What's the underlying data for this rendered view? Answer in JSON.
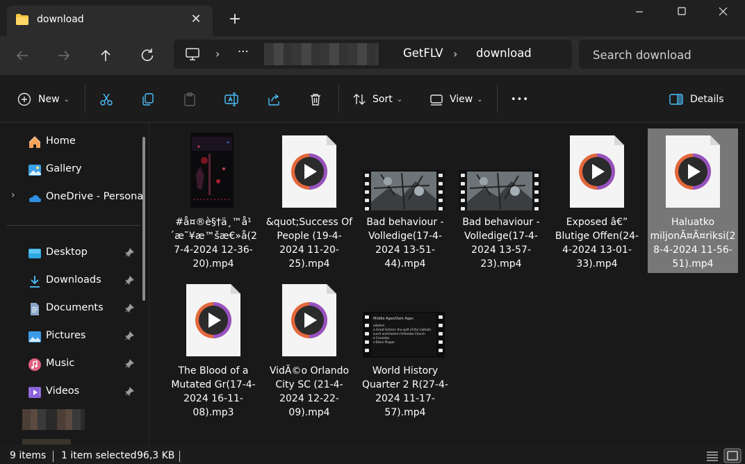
{
  "window": {
    "tab_title": "download",
    "new_tab_label": "+",
    "controls": {
      "minimize": "—",
      "maximize": "☐",
      "close": "✕"
    }
  },
  "address": {
    "ellipsis": "···",
    "crumbs": [
      "GetFLV",
      "download"
    ],
    "search_placeholder": "Search download"
  },
  "commands": {
    "new_label": "New",
    "sort_label": "Sort",
    "view_label": "View",
    "more_label": "•••",
    "details_label": "Details"
  },
  "sidebar": {
    "items": [
      {
        "label": "Home",
        "icon": "home-icon"
      },
      {
        "label": "Gallery",
        "icon": "gallery-icon"
      },
      {
        "label": "OneDrive - Personal",
        "icon": "onedrive-icon"
      },
      {
        "label": "Desktop",
        "icon": "desktop-icon",
        "pinned": true
      },
      {
        "label": "Downloads",
        "icon": "downloads-icon",
        "pinned": true
      },
      {
        "label": "Documents",
        "icon": "documents-icon",
        "pinned": true
      },
      {
        "label": "Pictures",
        "icon": "pictures-icon",
        "pinned": true
      },
      {
        "label": "Music",
        "icon": "music-icon",
        "pinned": true
      },
      {
        "label": "Videos",
        "icon": "videos-icon",
        "pinned": true
      }
    ]
  },
  "files": [
    {
      "name": "#å¤®è§†ä¸™å¹´æ˜¥æ™šæ€»å(27-4-2024 12-36-20).mp4",
      "thumb": "dark-video"
    },
    {
      "name": "&quot;Success Of People (19-4-2024 11-20-25).mp4",
      "thumb": "media-doc"
    },
    {
      "name": "Bad behaviour - Volledige(17-4-2024 13-51-44).mp4",
      "thumb": "filmstrip-tree"
    },
    {
      "name": "Bad behaviour - Volledige(17-4-2024 13-57-23).mp4",
      "thumb": "filmstrip-tree"
    },
    {
      "name": "Exposed â€” Blutige Offen(24-4-2024 13-01-33).mp4",
      "thumb": "media-doc"
    },
    {
      "name": "Haluatko miljonÃ¤Ã¤riksi(28-4-2024 11-56-51).mp4",
      "thumb": "media-doc",
      "selected": true
    },
    {
      "name": "The Blood of a Mutated Gr(17-4-2024 16-11-08).mp3",
      "thumb": "media-doc"
    },
    {
      "name": "VidÃ©o  Orlando City SC (21-4-2024 12-22-09).mp4",
      "thumb": "media-doc"
    },
    {
      "name": "World History Quarter 2 R(27-4-2024 11-17-57).mp4",
      "thumb": "filmstrip-text"
    }
  ],
  "slide_text": [
    "Middle Ages/Dark Ages",
    "udalism",
    "a Great Schism: the split of the Catholic",
    "surch and Eastern Orthodox Church",
    "e Crusades",
    "e Black Plague"
  ],
  "status": {
    "items_count": "9 items",
    "selected": "1 item selected",
    "size": "96,3 KB"
  },
  "colors": {
    "accent": "#4cc2ff",
    "folder": "#f4c542",
    "selection": "#777777",
    "window_bg": "#191919"
  }
}
